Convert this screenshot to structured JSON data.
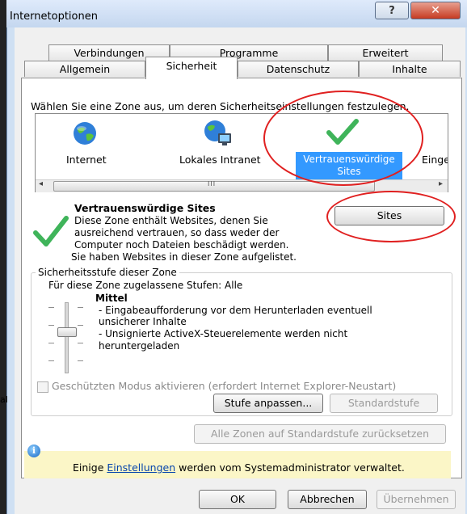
{
  "window": {
    "title": "Internetoptionen",
    "help_glyph": "?",
    "close_glyph": "✕"
  },
  "tabs": {
    "row1": [
      "Verbindungen",
      "Programme",
      "Erweitert"
    ],
    "row2": [
      "Allgemein",
      "Sicherheit",
      "Datenschutz",
      "Inhalte"
    ]
  },
  "zone_prompt": "Wählen Sie eine Zone aus, um deren Sicherheitseinstellungen festzulegen.",
  "zones": [
    {
      "label": "Internet",
      "icon": "globe-icon"
    },
    {
      "label": "Lokales Intranet",
      "icon": "network-globe-icon"
    },
    {
      "label": "Vertrauenswürdige Sites",
      "icon": "checkmark-icon",
      "selected": true
    },
    {
      "label": "Einge",
      "icon": "restricted-icon"
    }
  ],
  "scrollbar": {
    "left_arrow": "◂",
    "right_arrow": "▸",
    "grip": "III"
  },
  "zone_info": {
    "heading": "Vertrauenswürdige Sites",
    "line1": "Diese Zone enthält Websites, denen Sie",
    "line2": "ausreichend vertrauen, so dass weder der",
    "line3": "Computer noch Dateien beschädigt werden.",
    "line4": "Sie haben Websites in dieser Zone aufgelistet.",
    "sites_button": "Sites"
  },
  "security_level": {
    "group_label": "Sicherheitsstufe dieser Zone",
    "allowed": "Für diese Zone zugelassene Stufen: Alle",
    "level": "Mittel",
    "desc1": "- Eingabeaufforderung vor dem Herunterladen eventuell",
    "desc1b": "unsicherer Inhalte",
    "desc2": "- Unsignierte ActiveX-Steuerelemente werden nicht",
    "desc2b": "heruntergeladen",
    "protected_mode": "Geschützten Modus aktivieren (erfordert Internet Explorer-Neustart)",
    "protected_mode_checked": false,
    "custom_button": "Stufe anpassen...",
    "default_button": "Standardstufe"
  },
  "reset_all_button": "Alle Zonen auf Standardstufe zurücksetzen",
  "info_bar": {
    "prefix": "Einige ",
    "link": "Einstellungen",
    "suffix": " werden vom Systemadministrator verwaltet."
  },
  "footer": {
    "ok": "OK",
    "cancel": "Abbrechen",
    "apply": "Übernehmen"
  },
  "side_fragment": "al",
  "colors": {
    "selection": "#3399ff",
    "annotation": "#e02020",
    "infobar": "#fbf6c7",
    "check": "#3fb45a"
  }
}
